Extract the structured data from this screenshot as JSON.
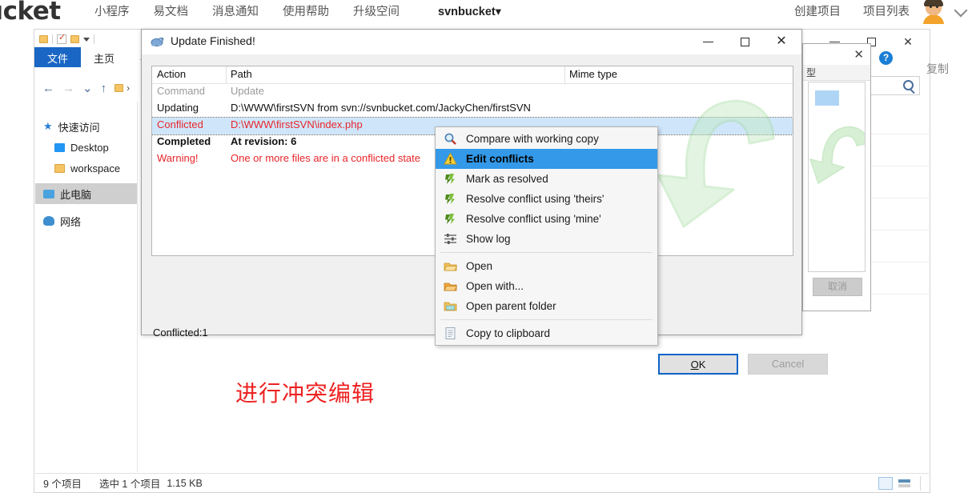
{
  "web_header": {
    "brand": "ucket",
    "nav_left": [
      "小程序",
      "易文档",
      "消息通知",
      "使用帮助",
      "升级空间"
    ],
    "project_dropdown": "svnbucket▾",
    "nav_right": [
      "创建项目",
      "项目列表"
    ],
    "avatar_name": "user-avatar",
    "chevron": "chevron-down-icon"
  },
  "explorer": {
    "ribbon_tabs": [
      "文件",
      "主页",
      "共"
    ],
    "nav_pane": [
      {
        "label": "快速访问",
        "icon": "star-icon"
      },
      {
        "label": "Desktop",
        "icon": "desktop-icon"
      },
      {
        "label": "workspace",
        "icon": "folder-icon"
      },
      {
        "label": "此电脑",
        "icon": "computer-icon",
        "selected": true
      },
      {
        "label": "网络",
        "icon": "network-icon"
      }
    ],
    "search_placeholder": "",
    "help_badge": "?",
    "copy_button": "复制",
    "status": {
      "item_count": "9 个项目",
      "selection": "选中 1 个项目",
      "size": "1.15 KB"
    }
  },
  "inner_window": {
    "column_header": "型",
    "cancel_button": "取消"
  },
  "dialog": {
    "title": "Update Finished!",
    "icon": "tortoise-svn-icon",
    "window_buttons": {
      "minimize": "minimize-icon",
      "maximize": "maximize-icon",
      "close": "close-icon"
    },
    "columns": [
      "Action",
      "Path",
      "Mime type"
    ],
    "rows": [
      {
        "action": "Command",
        "path": "Update",
        "style": "dim"
      },
      {
        "action": "Updating",
        "path": "D:\\WWW\\firstSVN from svn://svnbucket.com/JackyChen/firstSVN",
        "style": "normal"
      },
      {
        "action": "Conflicted",
        "path": "D:\\WWW\\firstSVN\\index.php",
        "style": "red",
        "selected": true
      },
      {
        "action": "Completed",
        "path": "At revision: 6",
        "style": "bold"
      },
      {
        "action": "Warning!",
        "path": "One or more files are in a conflicted state",
        "style": "red"
      }
    ],
    "conflict_count": "Conflicted:1",
    "ok_button": "OK",
    "ok_accel": "O",
    "cancel_button": "Cancel"
  },
  "context_menu": {
    "items": [
      {
        "label": "Compare with working copy",
        "icon": "magnifier-icon",
        "selected": false,
        "separator_after": false
      },
      {
        "label": "Edit conflicts",
        "icon": "conflict-warning-icon",
        "selected": true,
        "separator_after": false
      },
      {
        "label": "Mark as resolved",
        "icon": "resolve-icon",
        "selected": false,
        "separator_after": false
      },
      {
        "label": "Resolve conflict using 'theirs'",
        "icon": "resolve-icon",
        "selected": false,
        "separator_after": false
      },
      {
        "label": "Resolve conflict using 'mine'",
        "icon": "resolve-icon",
        "selected": false,
        "separator_after": false
      },
      {
        "label": "Show log",
        "icon": "show-log-icon",
        "selected": false,
        "separator_after": true
      },
      {
        "label": "Open",
        "icon": "open-folder-icon",
        "selected": false,
        "separator_after": false
      },
      {
        "label": "Open with...",
        "icon": "open-with-icon",
        "selected": false,
        "separator_after": false
      },
      {
        "label": "Open parent folder",
        "icon": "parent-folder-icon",
        "selected": false,
        "separator_after": true
      },
      {
        "label": "Copy to clipboard",
        "icon": "clipboard-icon",
        "selected": false,
        "separator_after": false
      }
    ]
  },
  "annotation": {
    "text": "进行冲突编辑",
    "color": "#ee2222"
  }
}
